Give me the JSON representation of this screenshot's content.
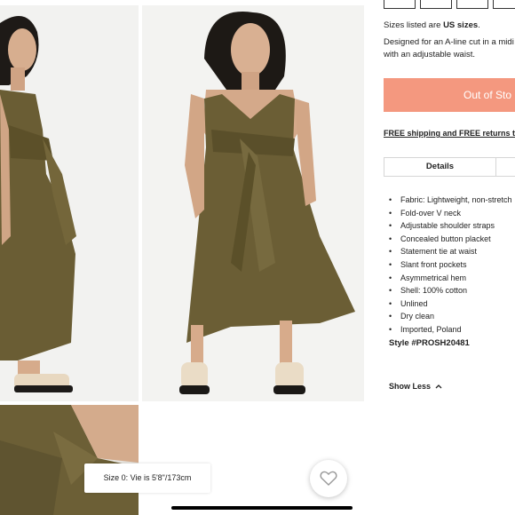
{
  "product": {
    "sizes_note_prefix": "Sizes listed are ",
    "sizes_note_bold": "US sizes",
    "sizes_note_suffix": ".",
    "description_line1": "Designed for an A-line cut in a midi le",
    "description_line2": "with an adjustable waist.",
    "oos_button_label": "Out of Sto",
    "shipping_text": "FREE shipping and FREE returns to C",
    "details_tab_label": "Details",
    "features": [
      "Fabric: Lightweight, non-stretch",
      "Fold-over V neck",
      "Adjustable shoulder straps",
      "Concealed button placket",
      "Statement tie at waist",
      "Slant front pockets",
      "Asymmetrical hem",
      "Shell: 100% cotton",
      "Unlined",
      "Dry clean",
      "Imported, Poland"
    ],
    "style_number": "Style #PROSH20481",
    "show_less_label": "Show Less"
  },
  "gallery": {
    "size_tag": "Size 0: Vie is 5'8\"/173cm"
  },
  "icons": {
    "heart": "heart-icon",
    "chevron": "chevron-up-icon"
  },
  "colors": {
    "button_bg": "#f4987f",
    "dress": "#6b5e35"
  }
}
